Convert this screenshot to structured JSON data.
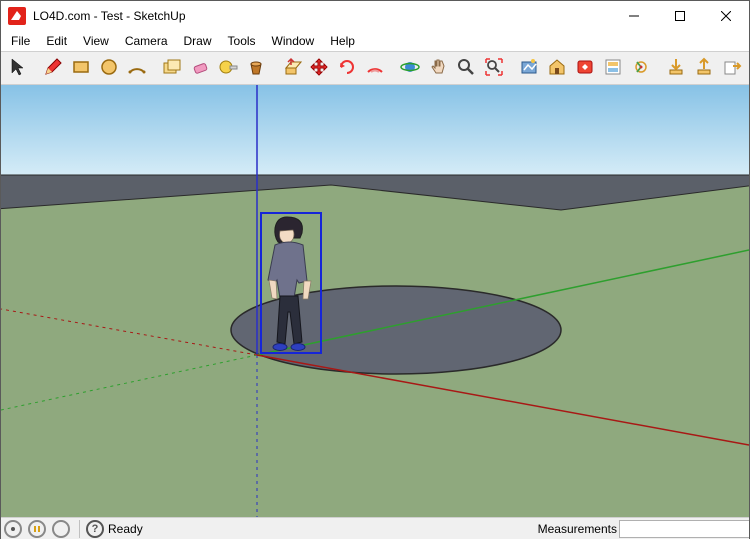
{
  "window": {
    "title": "LO4D.com - Test - SketchUp",
    "app_color": "#e2231a"
  },
  "menus": [
    "File",
    "Edit",
    "View",
    "Camera",
    "Draw",
    "Tools",
    "Window",
    "Help"
  ],
  "toolbar": [
    {
      "name": "select-tool",
      "icon": "cursor"
    },
    {
      "sep": true
    },
    {
      "name": "line-tool",
      "icon": "pencil"
    },
    {
      "name": "rectangle-tool",
      "icon": "rect"
    },
    {
      "name": "circle-tool",
      "icon": "circle"
    },
    {
      "name": "arc-tool",
      "icon": "arc"
    },
    {
      "sep": true
    },
    {
      "name": "make-component-tool",
      "icon": "component"
    },
    {
      "name": "eraser-tool",
      "icon": "eraser"
    },
    {
      "name": "tape-measure-tool",
      "icon": "tape"
    },
    {
      "name": "paint-bucket-tool",
      "icon": "bucket"
    },
    {
      "sep": true
    },
    {
      "name": "push-pull-tool",
      "icon": "pushpull"
    },
    {
      "name": "move-tool",
      "icon": "move"
    },
    {
      "name": "rotate-tool",
      "icon": "rotate"
    },
    {
      "name": "offset-tool",
      "icon": "offset"
    },
    {
      "sep": true
    },
    {
      "name": "orbit-tool",
      "icon": "orbit"
    },
    {
      "name": "pan-tool",
      "icon": "pan"
    },
    {
      "name": "zoom-tool",
      "icon": "zoom"
    },
    {
      "name": "zoom-extents-tool",
      "icon": "zoomextents"
    },
    {
      "sep": true
    },
    {
      "name": "add-location-tool",
      "icon": "location"
    },
    {
      "name": "3d-warehouse-tool",
      "icon": "warehouse"
    },
    {
      "name": "extension-warehouse-tool",
      "icon": "extwh"
    },
    {
      "name": "layout-tool",
      "icon": "layout"
    },
    {
      "name": "follow-me-tool",
      "icon": "followme"
    },
    {
      "sep": true
    },
    {
      "name": "download-tool",
      "icon": "download"
    },
    {
      "name": "upload-tool",
      "icon": "upload"
    },
    {
      "name": "export-tool",
      "icon": "export"
    }
  ],
  "status": {
    "ready": "Ready",
    "measurements_label": "Measurements",
    "measurements_value": ""
  },
  "scene": {
    "selection": "scale-figure",
    "axes": {
      "red": "#a81815",
      "green": "#2e9f2e",
      "blue": "#2a2fc7"
    },
    "ground_color": "#8fa97e",
    "sky_top": "#a8d2ee",
    "sky_bottom": "#d5ecf8",
    "shape_fill": "#616672"
  }
}
